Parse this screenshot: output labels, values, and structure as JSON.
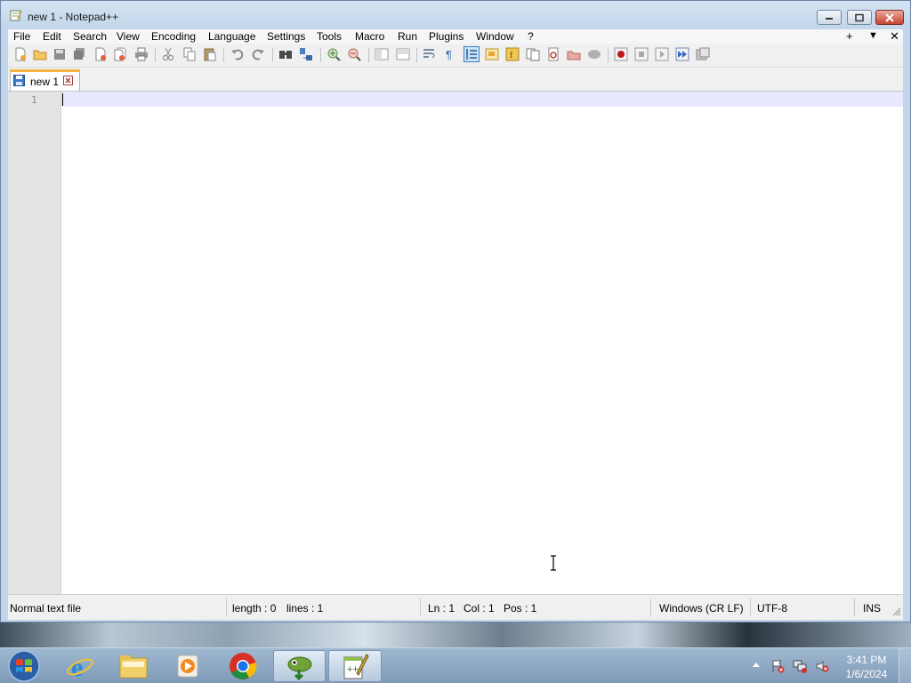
{
  "window": {
    "title": "new 1 - Notepad++"
  },
  "menu": [
    "File",
    "Edit",
    "Search",
    "View",
    "Encoding",
    "Language",
    "Settings",
    "Tools",
    "Macro",
    "Run",
    "Plugins",
    "Window",
    "?"
  ],
  "menu_right": {
    "plus": "+",
    "dropdown": "▼",
    "close": "✕"
  },
  "toolbar_icons": [
    "new-file-icon",
    "open-file-icon",
    "save-icon",
    "save-all-icon",
    "close-icon",
    "close-all-icon",
    "print-icon",
    "cut-icon",
    "copy-icon",
    "paste-icon",
    "undo-icon",
    "redo-icon",
    "find-icon",
    "replace-icon",
    "zoom-in-icon",
    "zoom-out-icon",
    "sync-vertical-icon",
    "sync-horizontal-icon",
    "word-wrap-icon",
    "show-all-chars-icon",
    "indent-guide-icon",
    "doc-map-icon",
    "function-list-icon",
    "folder-as-workspace-icon",
    "monitoring-icon",
    "record-macro-icon",
    "stop-macro-icon",
    "play-macro-icon",
    "run-macro-multiple-icon",
    "save-macro-icon"
  ],
  "tab": {
    "label": "new 1"
  },
  "editor": {
    "line_number": "1"
  },
  "status": {
    "filetype": "Normal text file",
    "length": "length : 0",
    "lines": "lines : 1",
    "ln": "Ln : 1",
    "col": "Col : 1",
    "pos": "Pos : 1",
    "eol": "Windows (CR LF)",
    "encoding": "UTF-8",
    "mode": "INS"
  },
  "taskbar": {
    "apps": [
      "start-button",
      "internet-explorer-icon",
      "file-explorer-icon",
      "media-player-icon",
      "chrome-icon",
      "gimp-icon",
      "notepadpp-icon"
    ],
    "time": "3:41 PM",
    "date": "1/6/2024"
  }
}
